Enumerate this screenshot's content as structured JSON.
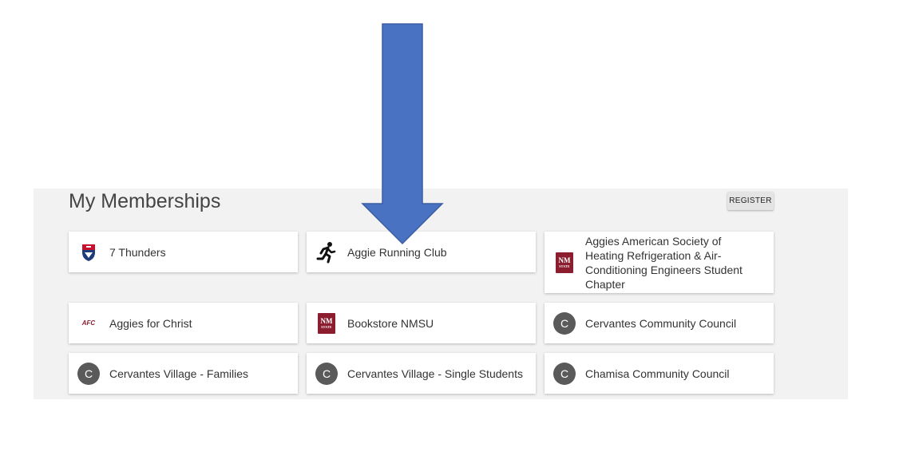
{
  "memberships": {
    "title": "My Memberships",
    "register_label": "REGISTER",
    "cards": [
      {
        "label": "7 Thunders",
        "icon": "shield-logo-icon"
      },
      {
        "label": "Aggie Running Club",
        "icon": "runner-icon"
      },
      {
        "label": "Aggies American Society of Heating Refrigeration & Air-Conditioning Engineers Student Chapter",
        "icon": "nmsu-logo-icon"
      },
      {
        "label": "Aggies for Christ",
        "icon": "afc-logo-icon"
      },
      {
        "label": "Bookstore NMSU",
        "icon": "nmsu-logo-icon"
      },
      {
        "label": "Cervantes Community Council",
        "icon": "letter-avatar-icon",
        "avatar_letter": "C"
      },
      {
        "label": "Cervantes Village - Families",
        "icon": "letter-avatar-icon",
        "avatar_letter": "C"
      },
      {
        "label": "Cervantes Village - Single Students",
        "icon": "letter-avatar-icon",
        "avatar_letter": "C"
      },
      {
        "label": "Chamisa Community Council",
        "icon": "letter-avatar-icon",
        "avatar_letter": "C"
      }
    ]
  },
  "logos": {
    "nmsu_main": "NM",
    "nmsu_sub": "STATE",
    "afc_text": "AFC"
  },
  "annotation": {
    "icon": "down-arrow-icon",
    "color": "#4a72c2"
  },
  "colors": {
    "panel_bg": "#f2f2f2",
    "nmsu_crimson": "#8c1d2f",
    "avatar_gray": "#5a5a5a"
  }
}
